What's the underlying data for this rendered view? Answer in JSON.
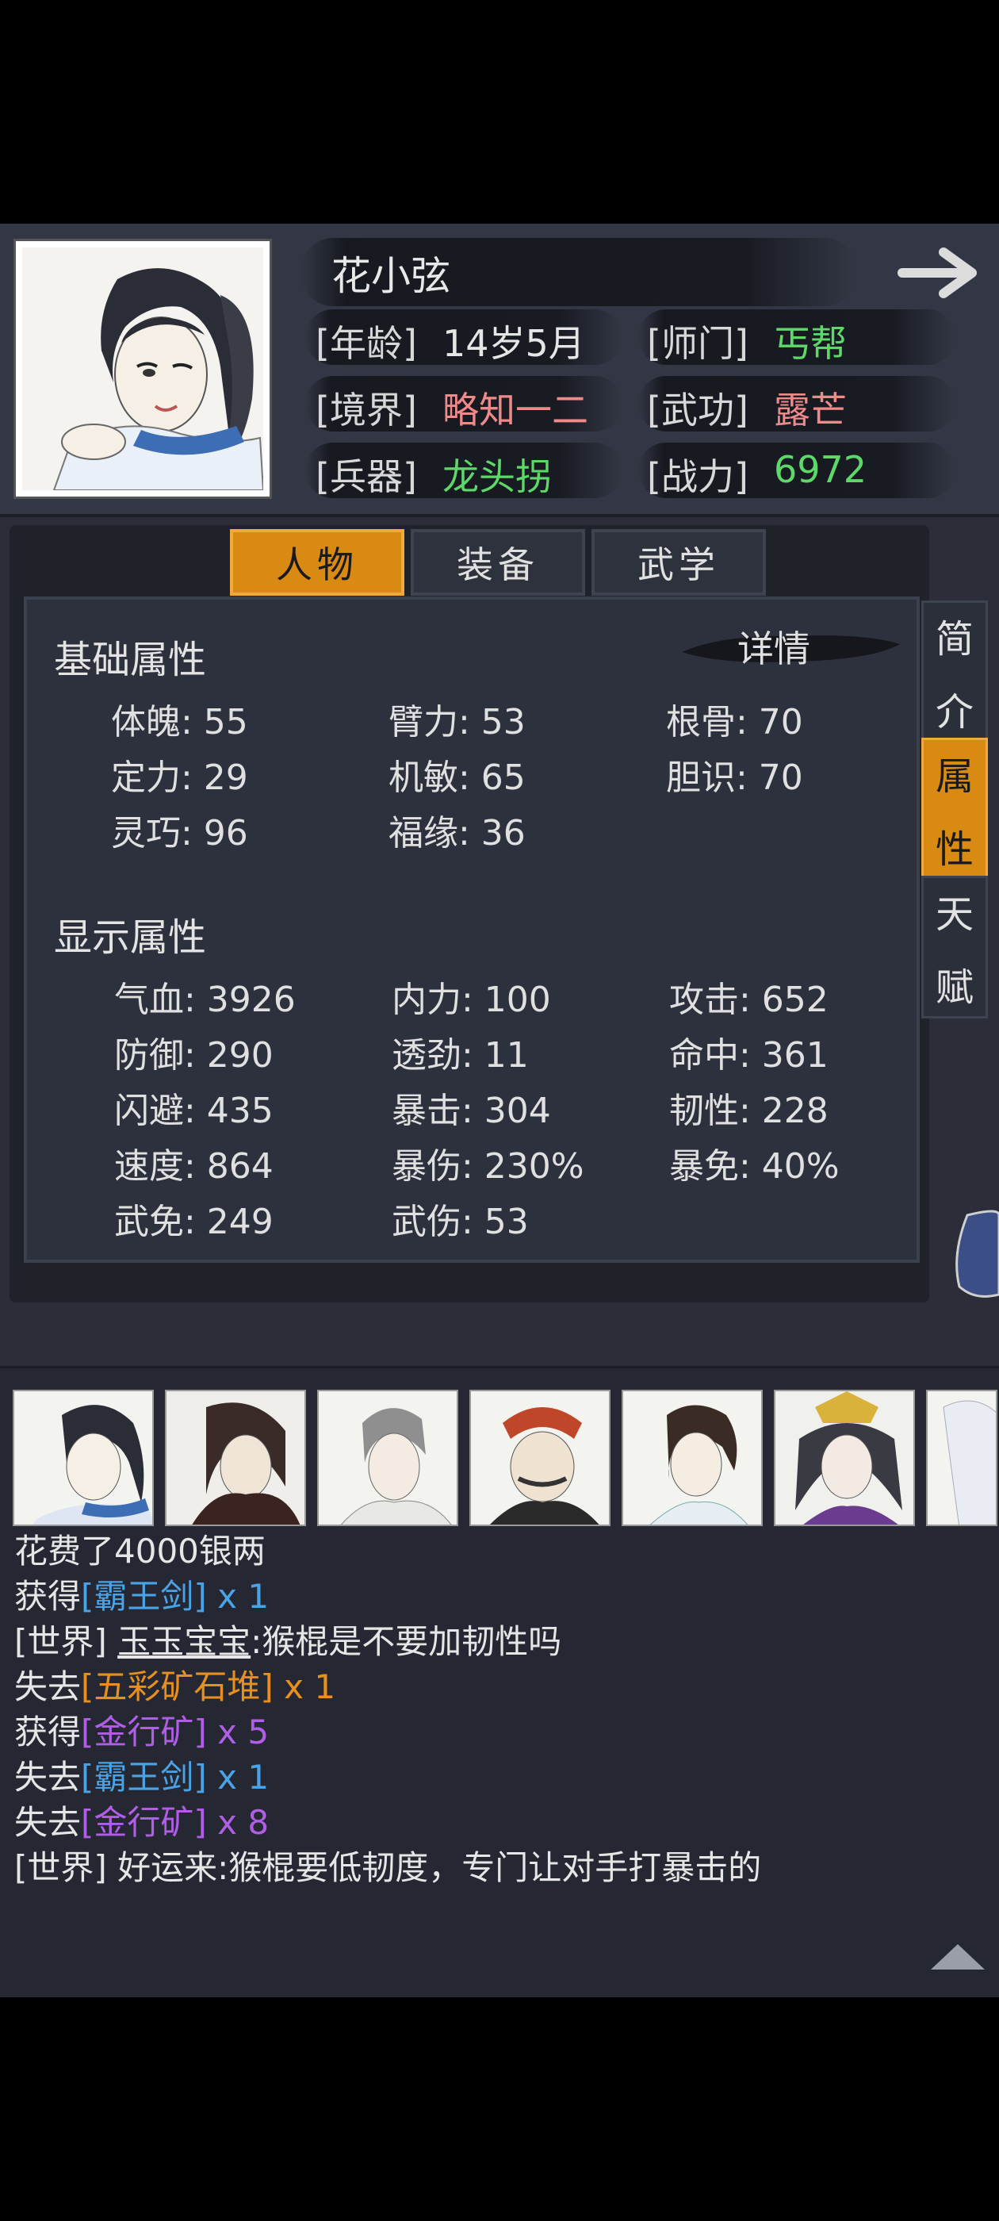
{
  "character": {
    "name": "花小弦",
    "age_label": "[年龄]",
    "age_value": "14岁5月",
    "sect_label": "[师门]",
    "sect_value": "丐帮",
    "realm_label": "[境界]",
    "realm_value": "略知一二",
    "martial_label": "[武功]",
    "martial_value": "露芒",
    "weapon_label": "[兵器]",
    "weapon_value": "龙头拐",
    "power_label": "[战力]",
    "power_value": "6972"
  },
  "colors": {
    "accent_orange": "#d98a13",
    "green_value": "#5fd86a",
    "pink_value": "#f08a8a",
    "link_blue": "#4aa3e6",
    "item_purple": "#b05ee6",
    "item_orange": "#e8901e"
  },
  "tabs": [
    "人物",
    "装备",
    "武学"
  ],
  "active_tab": "人物",
  "details_label": "详情",
  "side_tabs": [
    {
      "chars": [
        "简",
        "介"
      ],
      "active": false
    },
    {
      "chars": [
        "属",
        "性"
      ],
      "active": true
    },
    {
      "chars": [
        "天",
        "赋"
      ],
      "active": false
    }
  ],
  "basic": {
    "title": "基础属性",
    "stats": [
      {
        "label": "体魄: 55"
      },
      {
        "label": "臂力: 53"
      },
      {
        "label": "根骨: 70"
      },
      {
        "label": "定力: 29"
      },
      {
        "label": "机敏: 65"
      },
      {
        "label": "胆识: 70"
      },
      {
        "label": "灵巧: 96"
      },
      {
        "label": "福缘: 36"
      }
    ]
  },
  "display": {
    "title": "显示属性",
    "stats": [
      {
        "label": "气血: 3926"
      },
      {
        "label": "内力: 100"
      },
      {
        "label": "攻击: 652"
      },
      {
        "label": "防御: 290"
      },
      {
        "label": "透劲: 11"
      },
      {
        "label": "命中: 361"
      },
      {
        "label": "闪避: 435"
      },
      {
        "label": "暴击: 304"
      },
      {
        "label": "韧性: 228"
      },
      {
        "label": "速度: 864"
      },
      {
        "label": "暴伤: 230%"
      },
      {
        "label": "暴免: 40%"
      },
      {
        "label": "武免: 249"
      },
      {
        "label": "武伤: 53"
      }
    ]
  },
  "log": {
    "l1": "花费了4000银两",
    "l2_a": "获得",
    "l2_b": "[霸王剑]",
    "l2_c": " x 1",
    "l3_a": "[世界] ",
    "l3_b": "玉玉宝宝",
    "l3_c": ":猴棍是不要加韧性吗",
    "l4_a": "失去",
    "l4_b": "[五彩矿石堆]",
    "l4_c": " x 1",
    "l5_a": "获得",
    "l5_b": "[金行矿]",
    "l5_c": " x 5",
    "l6_a": "失去",
    "l6_b": "[霸王剑]",
    "l6_c": " x 1",
    "l7_a": "失去",
    "l7_b": "[金行矿]",
    "l7_c": " x 8",
    "l8_a": "[世界] ",
    "l8_b": "好运来:猴棍要低韧度，专门让对手打暴击的"
  },
  "icons": {
    "next": "arrow-right-icon",
    "scroll_up": "triangle-up-icon"
  }
}
